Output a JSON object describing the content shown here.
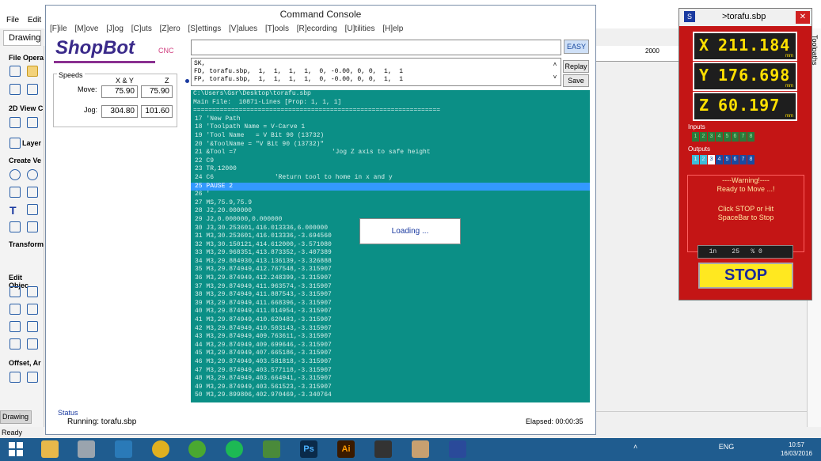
{
  "background_app": {
    "menu": [
      "File",
      "Edit"
    ],
    "drawing_tab": "Drawing",
    "sections": [
      "File Opera",
      "2D View C",
      "Layer",
      "Create Ve",
      "Transform",
      "Edit Objec",
      "Offset, Ar"
    ],
    "bottom_tab": "Drawing",
    "ruler_value": "2000",
    "right_tab": "Toolpaths",
    "status": "Ready"
  },
  "console": {
    "title": "Command Console",
    "menu": [
      "[F]ile",
      "[M]ove",
      "[J]og",
      "[C]uts",
      "[Z]ero",
      "[S]ettings",
      "[V]alues",
      "[T]ools",
      "[R]ecording",
      "[U]tilities",
      "[H]elp"
    ],
    "logo_text": "ShopBot",
    "logo_sub": "CNC",
    "command_value": "",
    "easy_label": "EASY",
    "replay_label": "Replay",
    "save_label": "Save",
    "history": [
      "SK,",
      "FD, torafu.sbp,  1,  1,  1,  1,  0, -0.00, 0, 0,  1,  1",
      "FP, torafu.sbp,  1,  1,  1,  1,  0, -0.00, 0, 0,  1,  1"
    ],
    "speeds": {
      "label": "Speeds",
      "col_xy": "X & Y",
      "col_z": "Z",
      "move_label": "Move:",
      "move_xy": "75.90",
      "move_z": "75.90",
      "jog_label": "Jog:",
      "jog_xy": "304.80",
      "jog_z": "101.60"
    },
    "code_header": [
      "C:\\Users\\Gsr\\Desktop\\torafu.sbp",
      "Main File:  10871-Lines [Prop: 1, 1, 1]",
      "================================================================="
    ],
    "code_lines": [
      "17 'New Path",
      "18 'Toolpath Name = V-Carve 1",
      "19 'Tool Name   = V Bit 90 (13732)",
      "20 '&ToolName = \"V Bit 90 (13732)\"",
      "21 &Tool =7                         'Jog Z axis to safe height",
      "22 C9",
      "23 TR,12000",
      "24 C6                'Return tool to home in x and y",
      "25 PAUSE 2",
      "26 '",
      "27 MS,75.9,75.9",
      "28 J2,20.000000",
      "29 J2,0.000000,0.000000",
      "30 J3,30.253601,416.013336,6.000000",
      "31 M3,30.253601,416.013336,-3.694560",
      "32 M3,30.150121,414.612000,-3.571080",
      "33 M3,29.968351,413.873352,-3.407389",
      "34 M3,29.884930,413.136139,-3.326888",
      "35 M3,29.874949,412.767548,-3.315907",
      "36 M3,29.874949,412.248399,-3.315907",
      "37 M3,29.874949,411.963574,-3.315907",
      "38 M3,29.874949,411.887543,-3.315907",
      "39 M3,29.874949,411.668396,-3.315907",
      "40 M3,29.874949,411.014954,-3.315907",
      "41 M3,29.874949,410.620483,-3.315907",
      "42 M3,29.874949,410.503143,-3.315907",
      "43 M3,29.874949,409.763611,-3.315907",
      "44 M3,29.874949,409.699646,-3.315907",
      "45 M3,29.874949,407.665186,-3.315907",
      "46 M3,29.874949,403.581818,-3.315907",
      "47 M3,29.874949,403.577118,-3.315907",
      "48 M3,29.874949,403.664941,-3.315907",
      "49 M3,29.874949,403.561523,-3.315907",
      "50 M3,29.899806,402.970469,-3.340764"
    ],
    "selected_line_index": 8,
    "loading_text": "Loading ...",
    "status_label": "Status",
    "running_text": "Running:  torafu.sbp",
    "elapsed_text": "Elapsed: 00:00:35"
  },
  "dro": {
    "title": ">torafu.sbp",
    "close": "✕",
    "x_label": "X",
    "x_value": "211.184",
    "y_label": "Y",
    "y_value": "176.698",
    "z_label": "Z",
    "z_value": "60.197",
    "unit": "mm",
    "inputs_label": "Inputs",
    "inputs": [
      "1",
      "2",
      "3",
      "4",
      "5",
      "6",
      "7",
      "8"
    ],
    "outputs_label": "Outputs",
    "outputs": [
      "1",
      "2",
      "3",
      "4",
      "5",
      "6",
      "7",
      "8"
    ],
    "active_output": "3",
    "warning_title": "----Warning!----",
    "warning_sub": "Ready to Move ...!",
    "warning_msg1": "Click STOP or Hit",
    "warning_msg2": "SpaceBar to Stop",
    "speed_readout": "  1n    25   % 0",
    "stop_label": "STOP",
    "colors": {
      "panel": "#c41515",
      "digits": "#ffe000",
      "stop": "#ffe820"
    }
  },
  "taskbar": {
    "tray_lang": "ENG",
    "time": "10:57",
    "date": "16/03/2016"
  }
}
